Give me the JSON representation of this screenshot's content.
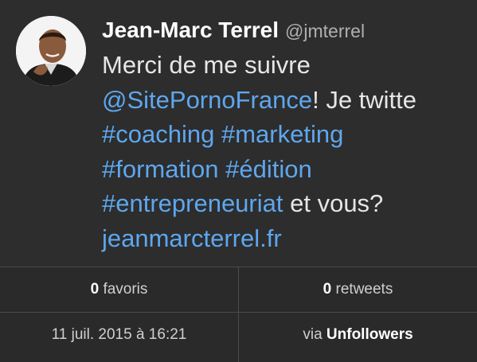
{
  "tweet": {
    "author_name": "Jean-Marc Terrel",
    "author_handle": "@jmterrel",
    "text_1": "Merci de me suivre",
    "mention": "@SitePornoFrance",
    "text_2": "! Je twitte",
    "hashtag_coaching": "#coaching",
    "hashtag_marketing": "#marketing",
    "hashtag_formation": "#formation",
    "hashtag_edition": "#édition",
    "hashtag_entrepreneuriat": "#entrepreneuriat",
    "text_3": " et vous?",
    "link": "jeanmarcterrel.fr"
  },
  "stats": {
    "favorites_count": "0",
    "favorites_label": "favoris",
    "retweets_count": "0",
    "retweets_label": "retweets",
    "timestamp": "11 juil. 2015 à 16:21",
    "via_label": "via",
    "via_app": "Unfollowers"
  },
  "colors": {
    "background": "#2d2d2d",
    "link": "#5ea7ee",
    "text": "#e6e6e6",
    "divider": "#4a4a4a"
  }
}
